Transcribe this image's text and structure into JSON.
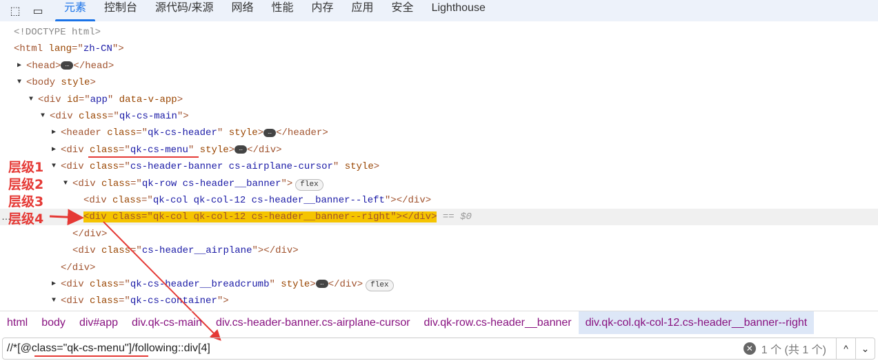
{
  "toolbar": {
    "inspect_icon": "inspect-element-icon",
    "device_icon": "device-toolbar-icon",
    "tabs": [
      "元素",
      "控制台",
      "源代码/来源",
      "网络",
      "性能",
      "内存",
      "应用",
      "安全",
      "Lighthouse"
    ],
    "active_tab": 0
  },
  "tree": [
    {
      "indent": 20,
      "arrow": "",
      "tokens": [
        [
          "doc",
          "<!DOCTYPE html>"
        ]
      ]
    },
    {
      "indent": 20,
      "arrow": "",
      "tokens": [
        [
          "tag",
          "<html "
        ],
        [
          "an",
          "lang"
        ],
        [
          "tag",
          "=\""
        ],
        [
          "av",
          "zh-CN"
        ],
        [
          "tag",
          "\">"
        ]
      ]
    },
    {
      "indent": 38,
      "arrow": "right",
      "tokens": [
        [
          "tag",
          "<head>"
        ],
        [
          "ell",
          "…"
        ],
        [
          "tag",
          "</head>"
        ]
      ]
    },
    {
      "indent": 38,
      "arrow": "down",
      "tokens": [
        [
          "tag",
          "<body "
        ],
        [
          "an",
          "style"
        ],
        [
          "tag",
          ">"
        ]
      ]
    },
    {
      "indent": 55,
      "arrow": "down",
      "tokens": [
        [
          "tag",
          "<div "
        ],
        [
          "an",
          "id"
        ],
        [
          "tag",
          "=\""
        ],
        [
          "av",
          "app"
        ],
        [
          "tag",
          "\" "
        ],
        [
          "an",
          "data-v-app"
        ],
        [
          "tag",
          ">"
        ]
      ]
    },
    {
      "indent": 72,
      "arrow": "down",
      "tokens": [
        [
          "tag",
          "<div "
        ],
        [
          "an",
          "class"
        ],
        [
          "tag",
          "=\""
        ],
        [
          "av",
          "qk-cs-main"
        ],
        [
          "tag",
          "\">"
        ]
      ]
    },
    {
      "indent": 88,
      "arrow": "right",
      "tokens": [
        [
          "tag",
          "<header "
        ],
        [
          "an",
          "class"
        ],
        [
          "tag",
          "=\""
        ],
        [
          "av",
          "qk-cs-header"
        ],
        [
          "tag",
          "\" "
        ],
        [
          "an",
          "style"
        ],
        [
          "tag",
          ">"
        ],
        [
          "ell",
          "…"
        ],
        [
          "tag",
          "</header>"
        ]
      ]
    },
    {
      "indent": 88,
      "arrow": "right",
      "tokens": [
        [
          "tag",
          "<div "
        ],
        [
          "an",
          "class"
        ],
        [
          "tag",
          "=\""
        ],
        [
          "av",
          "qk-cs-menu"
        ],
        [
          "tag",
          "\" "
        ],
        [
          "an",
          "style"
        ],
        [
          "tag",
          ">"
        ],
        [
          "ell",
          "…"
        ],
        [
          "tag",
          "</div>"
        ]
      ]
    },
    {
      "indent": 88,
      "arrow": "down",
      "tokens": [
        [
          "tag",
          "<div "
        ],
        [
          "an",
          "class"
        ],
        [
          "tag",
          "=\""
        ],
        [
          "av",
          "cs-header-banner cs-airplane-cursor"
        ],
        [
          "tag",
          "\" "
        ],
        [
          "an",
          "style"
        ],
        [
          "tag",
          ">"
        ]
      ]
    },
    {
      "indent": 105,
      "arrow": "down",
      "tokens": [
        [
          "tag",
          "<div "
        ],
        [
          "an",
          "class"
        ],
        [
          "tag",
          "=\""
        ],
        [
          "av",
          "qk-row cs-header__banner"
        ],
        [
          "tag",
          "\">"
        ],
        [
          "badge",
          "flex"
        ]
      ]
    },
    {
      "indent": 121,
      "arrow": "",
      "tokens": [
        [
          "tag",
          "<div "
        ],
        [
          "an",
          "class"
        ],
        [
          "tag",
          "=\""
        ],
        [
          "av",
          "qk-col qk-col-12 cs-header__banner--left"
        ],
        [
          "tag",
          "\"></div>"
        ]
      ]
    },
    {
      "indent": 121,
      "arrow": "",
      "selected": true,
      "tokens": [
        [
          "hl",
          "<div class=\"qk-col qk-col-12 cs-header__banner--right\"></div>"
        ],
        [
          "eq",
          " == $0"
        ]
      ]
    },
    {
      "indent": 105,
      "arrow": "",
      "tokens": [
        [
          "tag",
          "</div>"
        ]
      ]
    },
    {
      "indent": 105,
      "arrow": "",
      "tokens": [
        [
          "tag",
          "<div "
        ],
        [
          "an",
          "class"
        ],
        [
          "tag",
          "=\""
        ],
        [
          "av",
          "cs-header__airplane"
        ],
        [
          "tag",
          "\"></div>"
        ]
      ]
    },
    {
      "indent": 88,
      "arrow": "",
      "tokens": [
        [
          "tag",
          "</div>"
        ]
      ]
    },
    {
      "indent": 88,
      "arrow": "right",
      "tokens": [
        [
          "tag",
          "<div "
        ],
        [
          "an",
          "class"
        ],
        [
          "tag",
          "=\""
        ],
        [
          "av",
          "qk-cs-header__breadcrumb"
        ],
        [
          "tag",
          "\" "
        ],
        [
          "an",
          "style"
        ],
        [
          "tag",
          ">"
        ],
        [
          "ell",
          "…"
        ],
        [
          "tag",
          "</div>"
        ],
        [
          "badge",
          "flex"
        ]
      ]
    },
    {
      "indent": 88,
      "arrow": "down",
      "tokens": [
        [
          "tag",
          "<div "
        ],
        [
          "an",
          "class"
        ],
        [
          "tag",
          "=\""
        ],
        [
          "av",
          "qk-cs-container"
        ],
        [
          "tag",
          "\">"
        ]
      ]
    }
  ],
  "annotations": {
    "levels": [
      "层级1",
      "层级2",
      "层级3",
      "层级4"
    ],
    "color": "#e53935"
  },
  "breadcrumbs": [
    "html",
    "body",
    "div#app",
    "div.qk-cs-main",
    "div.cs-header-banner.cs-airplane-cursor",
    "div.qk-row.cs-header__banner",
    "div.qk-col.qk-col-12.cs-header__banner--right"
  ],
  "search": {
    "value": "//*[@class=\"qk-cs-menu\"]/following::div[4]",
    "count": "1 个 (共 1 个)",
    "prev": "^",
    "next": "⌄"
  }
}
